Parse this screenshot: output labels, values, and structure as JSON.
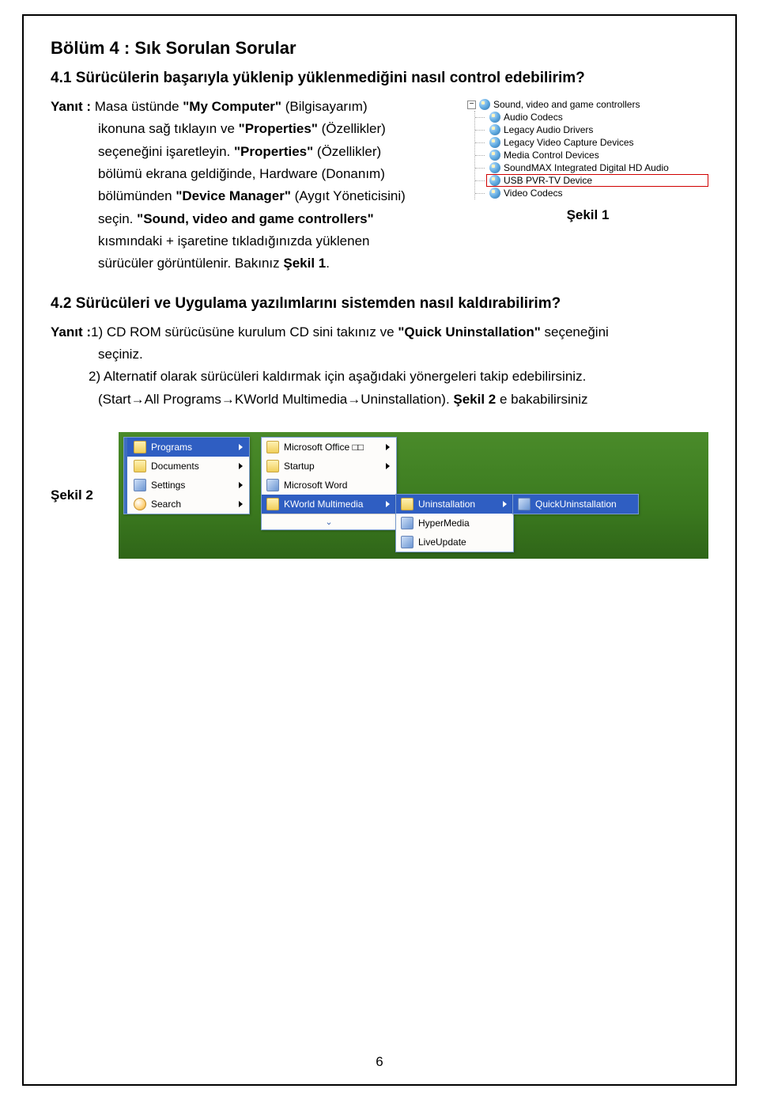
{
  "page": {
    "number": "6",
    "section_title": "Bölüm 4 : Sık Sorulan Sorular",
    "q1_title": "4.1 Sürücülerin başarıyla yüklenip yüklenmediğini nasıl control edebilirim?",
    "q2_title": "4.2 Sürücüleri ve Uygulama yazılımlarını sistemden nasıl kaldırabilirim?"
  },
  "answer1": {
    "lead": "Yanıt : ",
    "p1a": "Masa üstünde ",
    "p1b": "\"My Computer\"",
    "p1c": " (Bilgisayarım)",
    "p2a": "ikonuna sağ tıklayın ve ",
    "p2b": "\"Properties\"",
    "p2c": " (Özellikler)",
    "p3": "seçeneğini işaretleyin. ",
    "p3b": "\"Properties\"",
    "p3c": " (Özellikler)",
    "p4": "bölümü ekrana geldiğinde, Hardware (Donanım)",
    "p5a": "bölümünden ",
    "p5b": "\"Device Manager\"",
    "p5c": " (Aygıt Yöneticisini)",
    "p6a": "seçin. ",
    "p6b": "\"Sound, video and game controllers\"",
    "p7": "kısmındaki + işaretine tıkladığınızda yüklenen",
    "p8a": "sürücüler görüntülenir. Bakınız ",
    "p8b": "Şekil 1",
    "p8c": "."
  },
  "fig1": {
    "caption": "Şekil 1",
    "root_expander": "−",
    "root": "Sound, video and game controllers",
    "items": [
      "Audio Codecs",
      "Legacy Audio Drivers",
      "Legacy Video Capture Devices",
      "Media Control Devices",
      "SoundMAX Integrated Digital HD Audio",
      "USB PVR-TV Device",
      "Video Codecs"
    ],
    "highlight_index": 5
  },
  "answer2": {
    "lead": "Yanıt :",
    "l1a": "1) CD ROM sürücüsüne kurulum CD sini takınız ve ",
    "l1b": "\"Quick Uninstallation\"",
    "l1c": " seçeneğini",
    "l2": "seçiniz.",
    "l3": "2) Alternatif olarak sürücüleri kaldırmak için aşağıdaki yönergeleri takip edebilirsiniz.",
    "l4a": "(Start",
    "l4b": "All Programs",
    "l4c": "KWorld Multimedia",
    "l4d": "Uninstallation). ",
    "l4e": "Şekil 2",
    "l4f": " e bakabilirsiniz"
  },
  "fig2": {
    "caption": "Şekil 2",
    "left": [
      "Programs",
      "Documents",
      "Settings",
      "Search"
    ],
    "mid": [
      "Microsoft Office □□",
      "Startup",
      "Microsoft Word",
      "KWorld Multimedia"
    ],
    "sub": [
      "Uninstallation",
      "HyperMedia",
      "LiveUpdate"
    ],
    "leaf": [
      "QuickUninstallation"
    ]
  }
}
